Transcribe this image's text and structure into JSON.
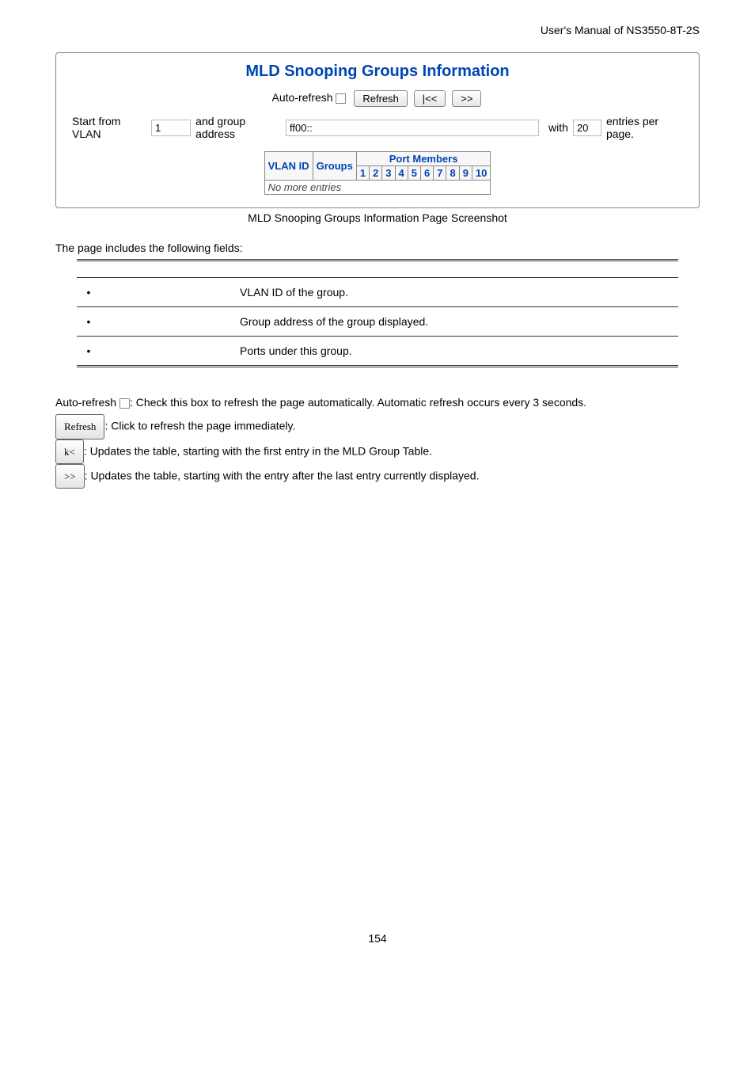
{
  "header": "User's Manual of NS3550-8T-2S",
  "screenshot": {
    "title": "MLD Snooping Groups Information",
    "autorefresh_label": "Auto-refresh",
    "refresh_btn": "Refresh",
    "first_btn": "|<<",
    "next_btn": ">>",
    "row2": {
      "t1": "Start from VLAN",
      "v1": "1",
      "t2": "and group address",
      "v2": "ff00::",
      "t3": "with",
      "v3": "20",
      "t4": "entries per page."
    },
    "table": {
      "col_vlan": "VLAN ID",
      "col_groups": "Groups",
      "col_pm": "Port Members",
      "ports": [
        "1",
        "2",
        "3",
        "4",
        "5",
        "6",
        "7",
        "8",
        "9",
        "10"
      ],
      "nomore": "No more entries"
    }
  },
  "caption": "MLD Snooping Groups Information Page Screenshot",
  "intro": "The page includes the following fields:",
  "fields": [
    {
      "desc": "VLAN ID of the group."
    },
    {
      "desc": "Group address of the group displayed."
    },
    {
      "desc": "Ports under this group."
    }
  ],
  "notes": {
    "autorefresh_pre": "Auto-refresh",
    "autorefresh": ": Check this box to refresh the page automatically. Automatic refresh occurs every 3 seconds.",
    "refresh_btn": "Refresh",
    "refresh": ": Click to refresh the page immediately.",
    "first_btn": "k<",
    "first": ": Updates the table, starting with the first entry in the MLD Group Table.",
    "next_btn": ">>",
    "next": ": Updates the table, starting with the entry after the last entry currently displayed."
  },
  "page_number": "154"
}
